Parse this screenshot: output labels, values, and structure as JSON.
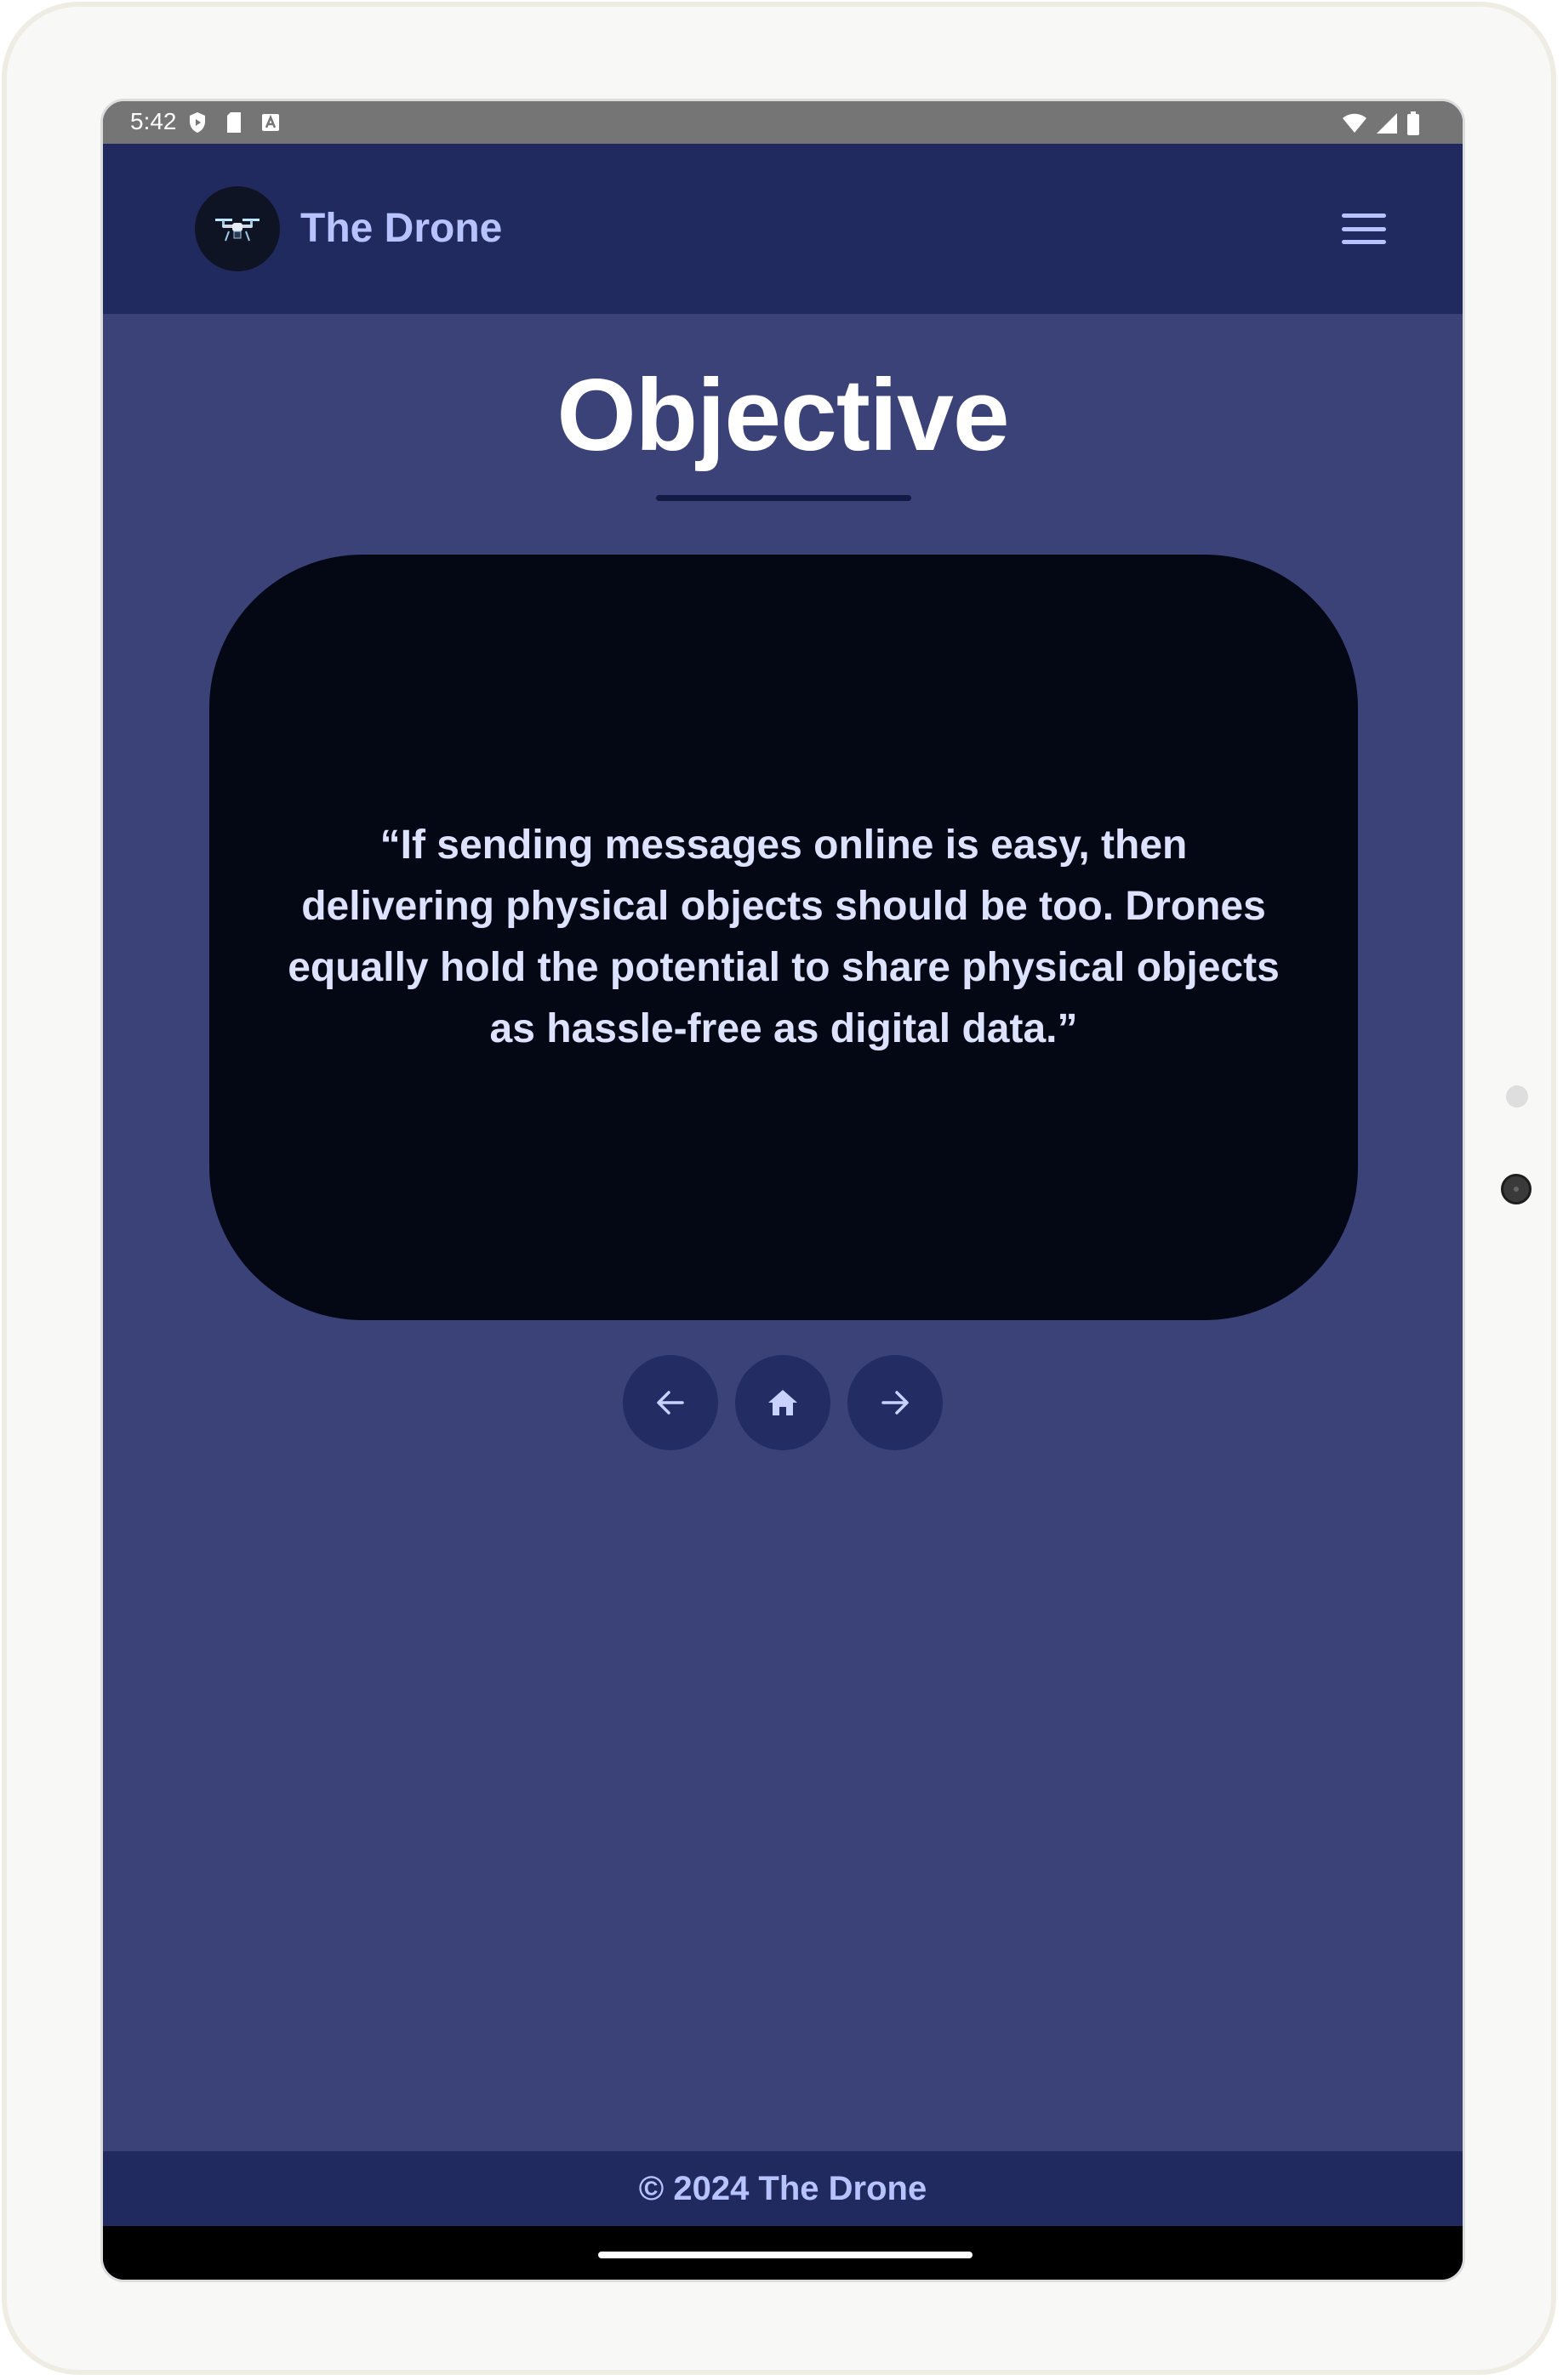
{
  "status_bar": {
    "time": "5:42",
    "icons_left": [
      "shield-icon",
      "sd-card-icon",
      "font-icon"
    ],
    "icons_right": [
      "wifi-icon",
      "signal-icon",
      "battery-icon"
    ]
  },
  "header": {
    "brand": "The Drone",
    "logo_icon": "drone-icon",
    "menu_icon": "hamburger-menu-icon"
  },
  "main": {
    "title": "Objective",
    "quote": "“If sending messages online is easy, then delivering physical objects should be too. Drones equally hold the potential to share physical objects as hassle-free as digital data.”"
  },
  "nav": {
    "prev_icon": "arrow-left-icon",
    "home_icon": "home-icon",
    "next_icon": "arrow-right-icon"
  },
  "footer": {
    "text": "© 2024 The Drone"
  },
  "colors": {
    "page_bg": "#3a4278",
    "header_bg": "#202a5f",
    "card_bg": "#040714",
    "accent": "#b7c3ff",
    "nav_button_bg": "#232c63"
  }
}
